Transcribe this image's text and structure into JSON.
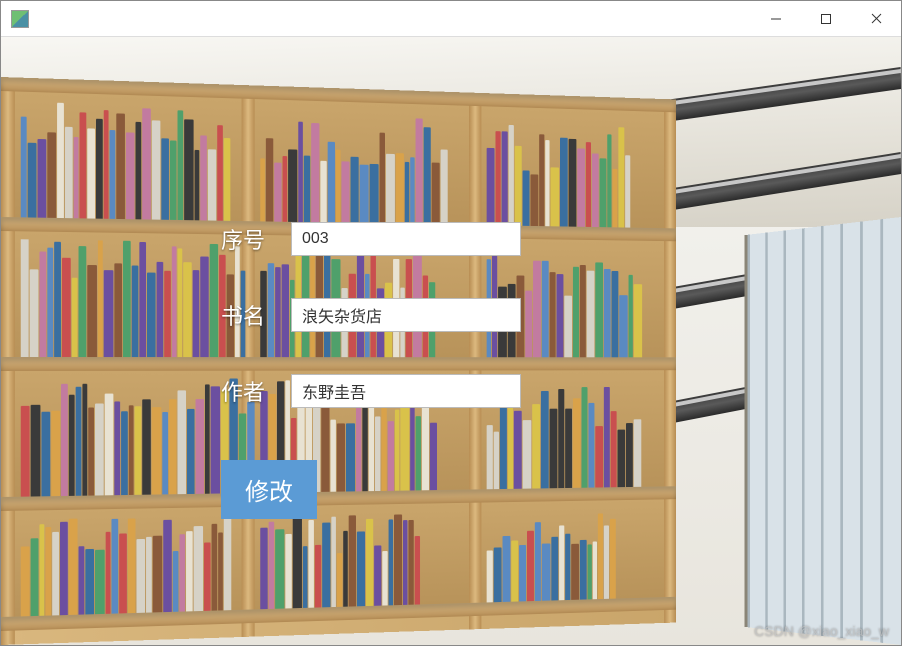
{
  "window": {
    "title": ""
  },
  "form": {
    "fields": {
      "id": {
        "label": "序号",
        "value": "003"
      },
      "name": {
        "label": "书名",
        "value": "浪矢杂货店"
      },
      "author": {
        "label": "作者",
        "value": "东野圭吾"
      }
    },
    "submit_label": "修改"
  },
  "watermark": "CSDN @xiao_xiao_w"
}
